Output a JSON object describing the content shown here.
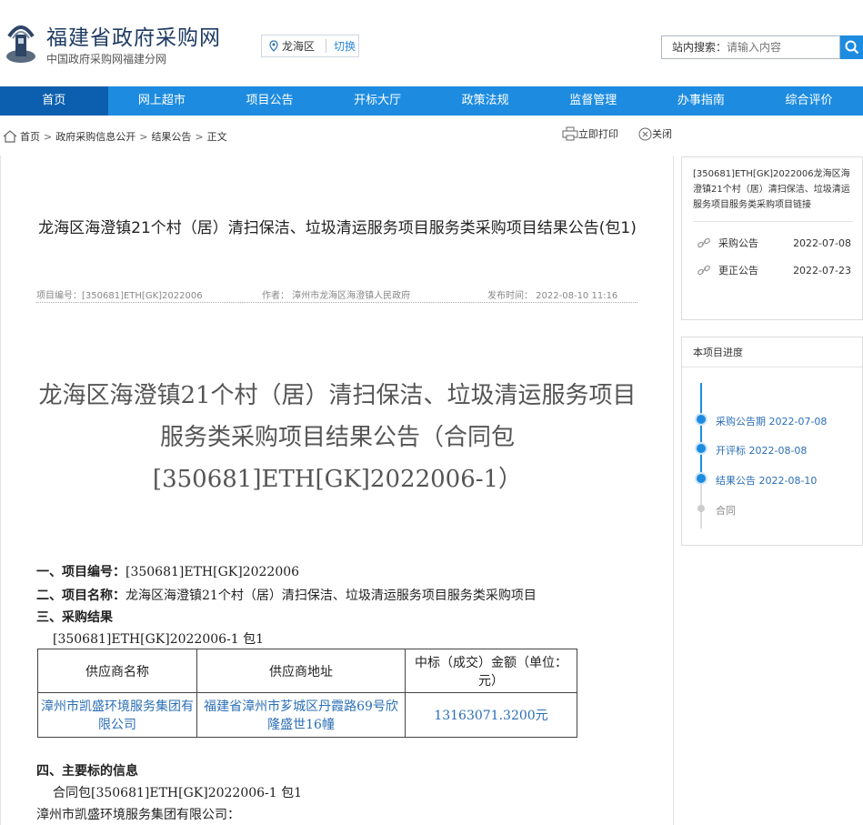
{
  "header": {
    "site_title": "福建省政府采购网",
    "site_subtitle": "中国政府采购网福建分网",
    "region": "龙海区",
    "region_switch": "切换",
    "search_label": "站内搜索：",
    "search_placeholder": "请输入内容"
  },
  "nav": {
    "items": [
      "首页",
      "网上超市",
      "项目公告",
      "开标大厅",
      "政策法规",
      "监督管理",
      "办事指南",
      "综合评价"
    ],
    "active_index": 0
  },
  "breadcrumb": {
    "items": [
      "首页",
      "政府采购信息公开",
      "结果公告",
      "正文"
    ],
    "print_label": "立即打印",
    "close_label": "关闭"
  },
  "document": {
    "title": "龙海区海澄镇21个村（居）清扫保洁、垃圾清运服务项目服务类采购项目结果公告(包1)",
    "meta": {
      "project_no": "项目编号：[350681]ETH[GK]2022006",
      "author": "作者： 漳州市龙海区海澄镇人民政府",
      "publish_time": "发布时间： 2022-08-10 11:16"
    },
    "announcement_title": "龙海区海澄镇21个村（居）清扫保洁、垃圾清运服务项目服务类采购项目结果公告（合同包[350681]ETH[GK]2022006-1）",
    "sec1_label": "一、项目编号：",
    "sec1_value": "[350681]ETH[GK]2022006",
    "sec2_label": "二、项目名称：",
    "sec2_value": "龙海区海澄镇21个村（居）清扫保洁、垃圾清运服务项目服务类采购项目",
    "sec3_label": "三、采购结果",
    "package_line": "[350681]ETH[GK]2022006-1 包1",
    "table": {
      "headers": [
        "供应商名称",
        "供应商地址",
        "中标（成交）金额（单位：元）"
      ],
      "rows": [
        [
          "漳州市凯盛环境服务集团有限公司",
          "福建省漳州市芗城区丹霞路69号欣隆盛世16幢",
          "13163071.3200元"
        ]
      ]
    },
    "sec4_label": "四、主要标的信息",
    "sec4_package": "合同包[350681]ETH[GK]2022006-1 包1",
    "sec4_supplier": "漳州市凯盛环境服务集团有限公司："
  },
  "sidebar": {
    "links_title": "[350681]ETH[GK]2022006龙海区海澄镇21个村（居）清扫保洁、垃圾清运服务项目服务类采购项目链接",
    "links": [
      {
        "label": "采购公告",
        "date": "2022-07-08"
      },
      {
        "label": "更正公告",
        "date": "2022-07-23"
      }
    ],
    "progress_title": "本项目进度",
    "progress": [
      {
        "label": "采购公告期 2022-07-08",
        "state": "done"
      },
      {
        "label": "开评标 2022-08-08",
        "state": "done"
      },
      {
        "label": "结果公告 2022-08-10",
        "state": "done"
      },
      {
        "label": "合同",
        "state": "pending"
      }
    ]
  },
  "colors": {
    "nav_bg": "#1d8ce0",
    "nav_active": "#0c5fae",
    "link_blue": "#2b6fb6",
    "progress_active": "#1d8ce0",
    "progress_pending": "#cccccc"
  }
}
